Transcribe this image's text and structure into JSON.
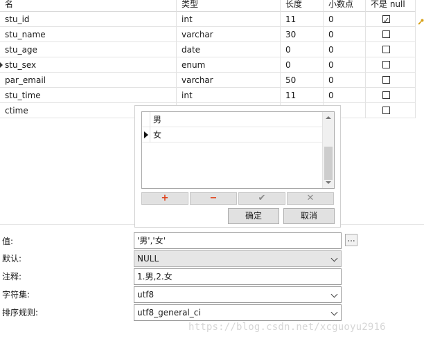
{
  "table": {
    "headers": [
      "名",
      "类型",
      "长度",
      "小数点",
      "不是 null"
    ],
    "rows": [
      {
        "name": "stu_id",
        "type": "int",
        "length": "11",
        "decimals": "0",
        "not_null": true
      },
      {
        "name": "stu_name",
        "type": "varchar",
        "length": "30",
        "decimals": "0",
        "not_null": false
      },
      {
        "name": "stu_age",
        "type": "date",
        "length": "0",
        "decimals": "0",
        "not_null": false
      },
      {
        "name": "stu_sex",
        "type": "enum",
        "length": "0",
        "decimals": "0",
        "not_null": false
      },
      {
        "name": "par_email",
        "type": "varchar",
        "length": "50",
        "decimals": "0",
        "not_null": false
      },
      {
        "name": "stu_time",
        "type": "int",
        "length": "11",
        "decimals": "0",
        "not_null": false
      },
      {
        "name": "ctime",
        "type": "",
        "length": "",
        "decimals": "",
        "not_null": false
      }
    ],
    "key_icon": "key-icon"
  },
  "enum_popup": {
    "items": [
      "男",
      "女"
    ],
    "selected_index": 1,
    "toolbar": {
      "add": "+",
      "remove": "−",
      "confirm_icon": "✔",
      "delete_icon": "✕"
    },
    "ok_label": "确定",
    "cancel_label": "取消"
  },
  "form": {
    "value_label": "值:",
    "value": "'男','女'",
    "ellipsis": "...",
    "default_label": "默认:",
    "default_value": "NULL",
    "comment_label": "注释:",
    "comment_value": "1.男,2.女",
    "charset_label": "字符集:",
    "charset_value": "utf8",
    "collation_label": "排序规则:",
    "collation_value": "utf8_general_ci"
  },
  "watermark": "https://blog.csdn.net/xcguoyu2916"
}
